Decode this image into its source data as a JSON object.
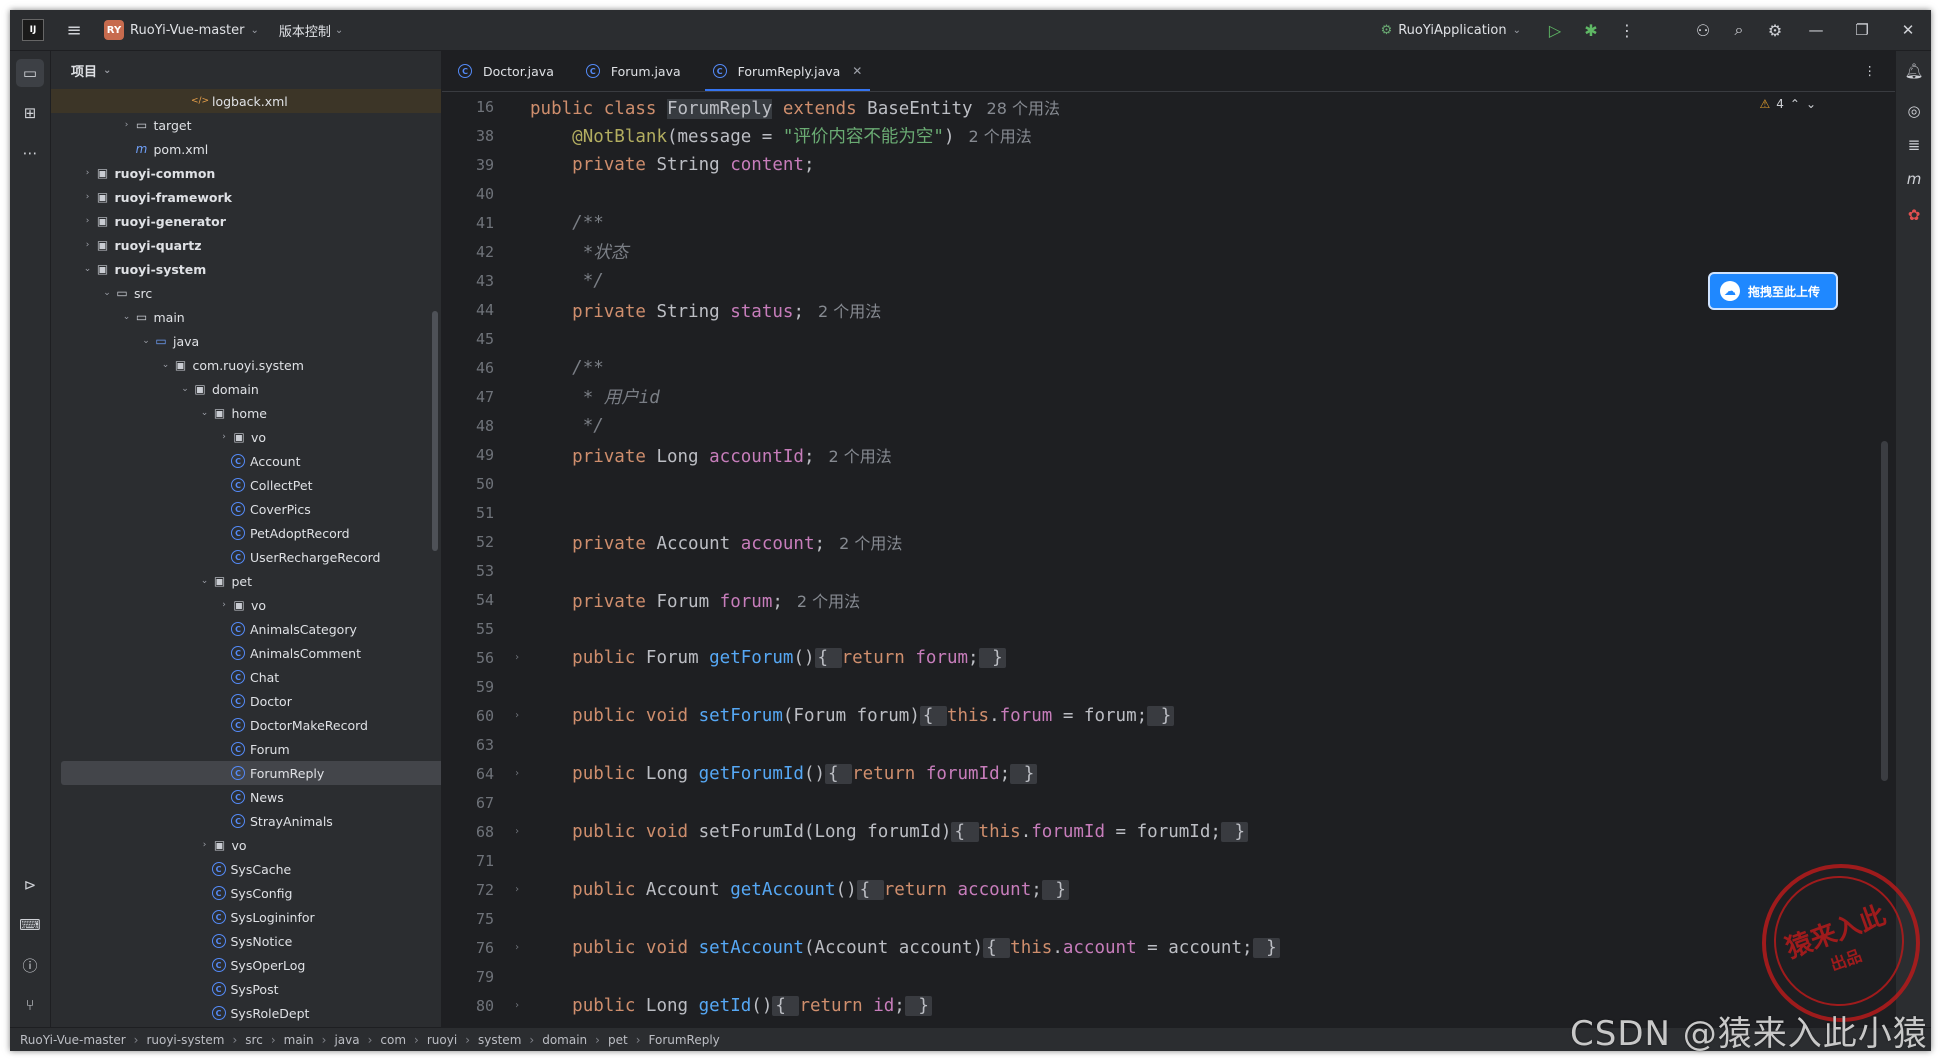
{
  "titlebar": {
    "project_badge": "RY",
    "project_name": "RuoYi-Vue-master",
    "vcs": "版本控制",
    "run_config": "RuoYiApplication"
  },
  "project_panel": {
    "header": "项目",
    "tree": [
      {
        "label": "logback.xml",
        "indent": 6,
        "type": "xml",
        "arrow": ""
      },
      {
        "label": "target",
        "indent": 3,
        "type": "folder",
        "arrow": ">"
      },
      {
        "label": "pom.xml",
        "indent": 3,
        "type": "maven",
        "arrow": ""
      },
      {
        "label": "ruoyi-common",
        "indent": 1,
        "type": "module",
        "arrow": ">",
        "bold": true
      },
      {
        "label": "ruoyi-framework",
        "indent": 1,
        "type": "module",
        "arrow": ">",
        "bold": true
      },
      {
        "label": "ruoyi-generator",
        "indent": 1,
        "type": "module",
        "arrow": ">",
        "bold": true
      },
      {
        "label": "ruoyi-quartz",
        "indent": 1,
        "type": "module",
        "arrow": ">",
        "bold": true
      },
      {
        "label": "ruoyi-system",
        "indent": 1,
        "type": "module",
        "arrow": "v",
        "bold": true
      },
      {
        "label": "src",
        "indent": 2,
        "type": "folder",
        "arrow": "v"
      },
      {
        "label": "main",
        "indent": 3,
        "type": "folder",
        "arrow": "v"
      },
      {
        "label": "java",
        "indent": 4,
        "type": "folder-src",
        "arrow": "v"
      },
      {
        "label": "com.ruoyi.system",
        "indent": 5,
        "type": "package",
        "arrow": "v"
      },
      {
        "label": "domain",
        "indent": 6,
        "type": "package",
        "arrow": "v"
      },
      {
        "label": "home",
        "indent": 7,
        "type": "package",
        "arrow": "v"
      },
      {
        "label": "vo",
        "indent": 8,
        "type": "package",
        "arrow": ">"
      },
      {
        "label": "Account",
        "indent": 8,
        "type": "class",
        "arrow": ""
      },
      {
        "label": "CollectPet",
        "indent": 8,
        "type": "class",
        "arrow": ""
      },
      {
        "label": "CoverPics",
        "indent": 8,
        "type": "class",
        "arrow": ""
      },
      {
        "label": "PetAdoptRecord",
        "indent": 8,
        "type": "class",
        "arrow": ""
      },
      {
        "label": "UserRechargeRecord",
        "indent": 8,
        "type": "class",
        "arrow": ""
      },
      {
        "label": "pet",
        "indent": 7,
        "type": "package",
        "arrow": "v"
      },
      {
        "label": "vo",
        "indent": 8,
        "type": "package",
        "arrow": ">"
      },
      {
        "label": "AnimalsCategory",
        "indent": 8,
        "type": "class",
        "arrow": ""
      },
      {
        "label": "AnimalsComment",
        "indent": 8,
        "type": "class",
        "arrow": ""
      },
      {
        "label": "Chat",
        "indent": 8,
        "type": "class",
        "arrow": ""
      },
      {
        "label": "Doctor",
        "indent": 8,
        "type": "class",
        "arrow": ""
      },
      {
        "label": "DoctorMakeRecord",
        "indent": 8,
        "type": "class",
        "arrow": ""
      },
      {
        "label": "Forum",
        "indent": 8,
        "type": "class",
        "arrow": ""
      },
      {
        "label": "ForumReply",
        "indent": 8,
        "type": "class",
        "arrow": "",
        "selected": true
      },
      {
        "label": "News",
        "indent": 8,
        "type": "class",
        "arrow": ""
      },
      {
        "label": "StrayAnimals",
        "indent": 8,
        "type": "class",
        "arrow": ""
      },
      {
        "label": "vo",
        "indent": 7,
        "type": "package",
        "arrow": ">"
      },
      {
        "label": "SysCache",
        "indent": 7,
        "type": "class",
        "arrow": ""
      },
      {
        "label": "SysConfig",
        "indent": 7,
        "type": "class",
        "arrow": ""
      },
      {
        "label": "SysLogininfor",
        "indent": 7,
        "type": "class",
        "arrow": ""
      },
      {
        "label": "SysNotice",
        "indent": 7,
        "type": "class",
        "arrow": ""
      },
      {
        "label": "SysOperLog",
        "indent": 7,
        "type": "class",
        "arrow": ""
      },
      {
        "label": "SysPost",
        "indent": 7,
        "type": "class",
        "arrow": ""
      },
      {
        "label": "SysRoleDept",
        "indent": 7,
        "type": "class",
        "arrow": ""
      }
    ]
  },
  "editor": {
    "tabs": [
      {
        "label": "Doctor.java",
        "active": false
      },
      {
        "label": "Forum.java",
        "active": false
      },
      {
        "label": "ForumReply.java",
        "active": true
      }
    ],
    "warnings": "4",
    "lines": [
      {
        "n": "16",
        "html": "<span class='kw'>public class </span><span class='plain hl'>ForumReply</span><span class='kw'> extends </span><span class='plain'>BaseEntity</span><span class='hint'>28 个用法</span>"
      },
      {
        "n": "38",
        "html": "    <span class='ann'>@NotBlank</span><span class='plain'>(message = </span><span class='str'>\"评价内容不能为空\"</span><span class='plain'>)</span><span class='hint'>2 个用法</span>"
      },
      {
        "n": "39",
        "html": "    <span class='kw'>private </span><span class='plain'>String </span><span class='fld'>content</span><span class='plain'>;</span>"
      },
      {
        "n": "40",
        "html": ""
      },
      {
        "n": "41",
        "html": "    <span class='cmt'>/**</span>"
      },
      {
        "n": "42",
        "html": "    <span class='cmt'> *状态</span>"
      },
      {
        "n": "43",
        "html": "    <span class='cmt'> */</span>"
      },
      {
        "n": "44",
        "html": "    <span class='kw'>private </span><span class='plain'>String </span><span class='fld'>status</span><span class='plain'>;</span><span class='hint'>2 个用法</span>"
      },
      {
        "n": "45",
        "html": ""
      },
      {
        "n": "46",
        "html": "    <span class='cmt'>/**</span>"
      },
      {
        "n": "47",
        "html": "    <span class='cmt'> * 用户id</span>"
      },
      {
        "n": "48",
        "html": "    <span class='cmt'> */</span>"
      },
      {
        "n": "49",
        "html": "    <span class='kw'>private </span><span class='plain'>Long </span><span class='fld'>accountId</span><span class='plain'>;</span><span class='hint'>2 个用法</span>"
      },
      {
        "n": "50",
        "html": ""
      },
      {
        "n": "51",
        "html": ""
      },
      {
        "n": "52",
        "html": "    <span class='kw'>private </span><span class='plain'>Account </span><span class='fld'>account</span><span class='plain'>;</span><span class='hint'>2 个用法</span>"
      },
      {
        "n": "53",
        "html": ""
      },
      {
        "n": "54",
        "html": "    <span class='kw'>private </span><span class='plain'>Forum </span><span class='fld'>forum</span><span class='plain'>;</span><span class='hint'>2 个用法</span>"
      },
      {
        "n": "55",
        "html": ""
      },
      {
        "n": "56",
        "fold": true,
        "html": "    <span class='kw'>public </span><span class='plain'>Forum </span><span class='fn'>getForum</span><span class='plain'>()</span><span class='foldbox'>{ </span><span class='kw'>return </span><span class='fld'>forum</span><span class='plain'>;</span><span class='foldbox'> }</span>"
      },
      {
        "n": "59",
        "html": ""
      },
      {
        "n": "60",
        "fold": true,
        "html": "    <span class='kw'>public void </span><span class='fn'>setForum</span><span class='plain'>(Forum forum)</span><span class='foldbox'>{ </span><span class='kw'>this</span><span class='plain'>.</span><span class='fld'>forum</span><span class='plain'> = forum;</span><span class='foldbox'> }</span>"
      },
      {
        "n": "63",
        "html": ""
      },
      {
        "n": "64",
        "fold": true,
        "html": "    <span class='kw'>public </span><span class='plain'>Long </span><span class='fn'>getForumId</span><span class='plain'>()</span><span class='foldbox'>{ </span><span class='kw'>return </span><span class='fld'>forumId</span><span class='plain'>;</span><span class='foldbox'> }</span>"
      },
      {
        "n": "67",
        "html": ""
      },
      {
        "n": "68",
        "fold": true,
        "html": "    <span class='kw'>public void </span><span class='plain'>setForumId(Long forumId)</span><span class='foldbox'>{ </span><span class='kw'>this</span><span class='plain'>.</span><span class='fld'>forumId</span><span class='plain'> = forumId;</span><span class='foldbox'> }</span>"
      },
      {
        "n": "71",
        "html": ""
      },
      {
        "n": "72",
        "fold": true,
        "html": "    <span class='kw'>public </span><span class='plain'>Account </span><span class='fn'>getAccount</span><span class='plain'>()</span><span class='foldbox'>{ </span><span class='kw'>return </span><span class='fld'>account</span><span class='plain'>;</span><span class='foldbox'> }</span>"
      },
      {
        "n": "75",
        "html": ""
      },
      {
        "n": "76",
        "fold": true,
        "html": "    <span class='kw'>public void </span><span class='fn'>setAccount</span><span class='plain'>(Account account)</span><span class='foldbox'>{ </span><span class='kw'>this</span><span class='plain'>.</span><span class='fld'>account</span><span class='plain'> = account;</span><span class='foldbox'> }</span>"
      },
      {
        "n": "79",
        "html": ""
      },
      {
        "n": "80",
        "fold": true,
        "html": "    <span class='kw'>public </span><span class='plain'>Long </span><span class='fn'>getId</span><span class='plain'>()</span><span class='foldbox'>{ </span><span class='kw'>return </span><span class='fld'>id</span><span class='plain'>;</span><span class='foldbox'> }</span>"
      }
    ]
  },
  "statusbar": {
    "crumbs": [
      "RuoYi-Vue-master",
      "ruoyi-system",
      "src",
      "main",
      "java",
      "com",
      "ruoyi",
      "system",
      "domain",
      "pet",
      "ForumReply"
    ]
  },
  "overlay": {
    "upload_label": "拖拽至此上传",
    "seal_top": "猿来入此",
    "seal_bottom": "出品",
    "watermark": "CSDN @猿来入此小猿"
  },
  "colors": {
    "accent": "#3574f0",
    "keyword": "#cf8e6d",
    "field": "#c77dbb",
    "method": "#56a8f5",
    "string": "#6aab73",
    "comment": "#7a7e85"
  }
}
